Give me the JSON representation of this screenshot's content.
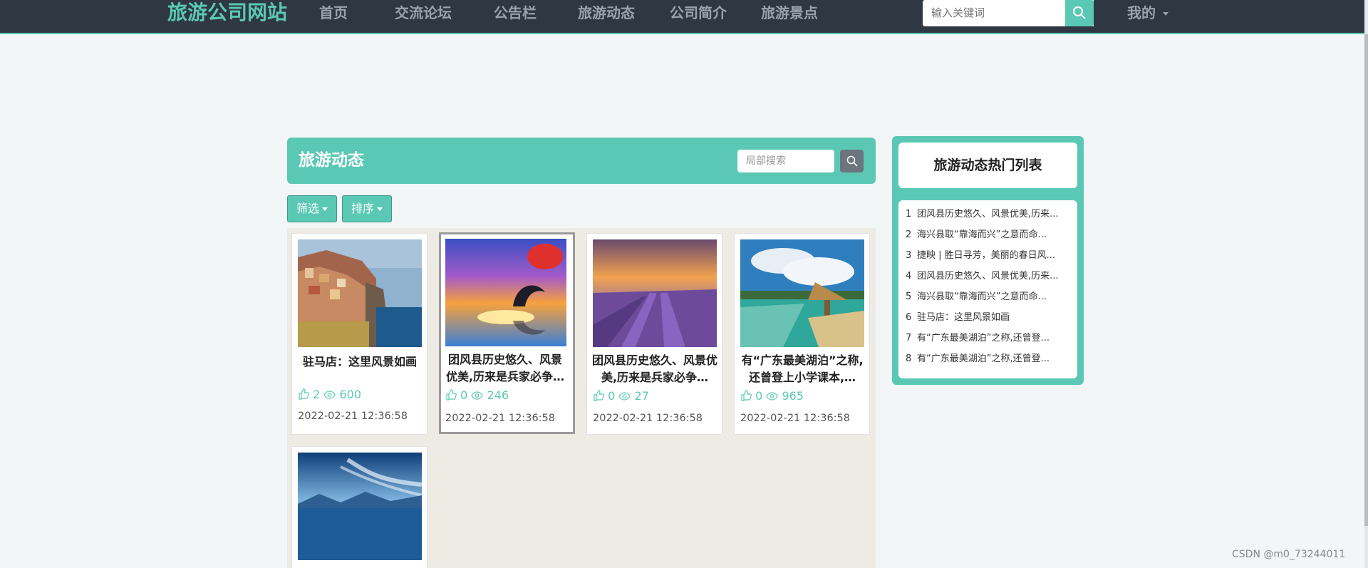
{
  "nav": {
    "brand": "旅游公司网站",
    "items": [
      "首页",
      "交流论坛",
      "公告栏",
      "旅游动态",
      "公司简介",
      "旅游景点"
    ],
    "search_placeholder": "输入关键词",
    "user_menu": "我的"
  },
  "main": {
    "title": "旅游动态",
    "local_search_placeholder": "局部搜索",
    "filter_label": "筛选",
    "sort_label": "排序",
    "cards": [
      {
        "title": "驻马店：这里风景如画",
        "likes": "2",
        "views": "600",
        "date": "2022-02-21 12:36:58"
      },
      {
        "title": "团风县历史悠久、风景优美,历来是兵家必争…",
        "likes": "0",
        "views": "246",
        "date": "2022-02-21 12:36:58"
      },
      {
        "title": "团风县历史悠久、风景优美,历来是兵家必争…",
        "likes": "0",
        "views": "27",
        "date": "2022-02-21 12:36:58"
      },
      {
        "title": "有“广东最美湖泊”之称,还曾登上小学课本,…",
        "likes": "0",
        "views": "965",
        "date": "2022-02-21 12:36:58"
      }
    ]
  },
  "hot": {
    "title": "旅游动态热门列表",
    "items": [
      {
        "num": "1",
        "text": "团风县历史悠久、风景优美,历来..."
      },
      {
        "num": "2",
        "text": "海兴县取“靠海而兴”之意而命..."
      },
      {
        "num": "3",
        "text": "捷映 | 胜日寻芳，美丽的春日风..."
      },
      {
        "num": "4",
        "text": "团风县历史悠久、风景优美,历来..."
      },
      {
        "num": "5",
        "text": "海兴县取“靠海而兴”之意而命..."
      },
      {
        "num": "6",
        "text": "驻马店：这里风景如画"
      },
      {
        "num": "7",
        "text": "有“广东最美湖泊”之称,还曾登..."
      },
      {
        "num": "8",
        "text": "有“广东最美湖泊”之称,还曾登..."
      }
    ]
  },
  "watermark": "CSDN @m0_73244011",
  "colors": {
    "accent": "#5ac8b4",
    "nav_bg": "#2f3742",
    "page_bg": "#f3f6f7"
  }
}
